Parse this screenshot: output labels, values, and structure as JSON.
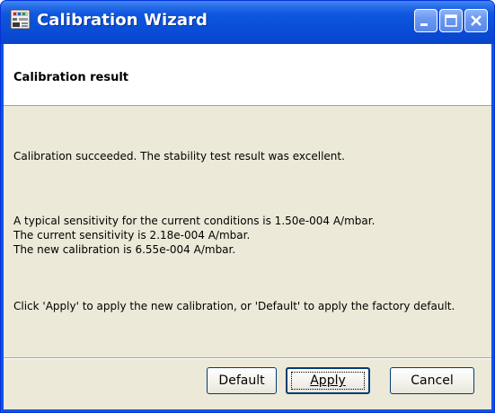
{
  "window": {
    "title": "Calibration Wizard",
    "icon": "calibration-wizard-app-icon",
    "caption_buttons": [
      "minimize-icon",
      "maximize-icon",
      "close-icon"
    ]
  },
  "header": {
    "title": "Calibration result"
  },
  "messages": {
    "succeeded": "Calibration succeeded.  The stability test result was excellent.",
    "typical_sensitivity": "A typical sensitivity for the current conditions is 1.50e-004 A/mbar.",
    "current_sensitivity": "The current sensitivity is 2.18e-004 A/mbar.",
    "new_calibration": "The new calibration is 6.55e-004 A/mbar.",
    "instruction": "Click 'Apply' to apply the new calibration, or 'Default' to apply the factory default."
  },
  "buttons": {
    "default_label": "Default",
    "apply_label": "Apply",
    "cancel_label": "Cancel",
    "focused": "Apply"
  },
  "colors": {
    "titlebar": "#0a54e3",
    "dialog_background": "#ece9d8",
    "header_background": "#ffffff",
    "button_border": "#003c74"
  }
}
